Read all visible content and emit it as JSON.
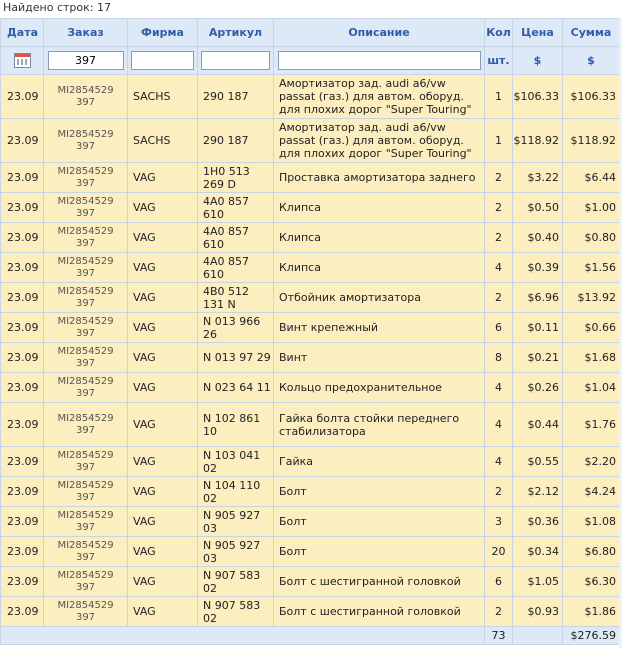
{
  "found_rows": "Найдено строк: 17",
  "columns": {
    "date": "Дата",
    "order": "Заказ",
    "firm": "Фирма",
    "article": "Артикул",
    "description": "Описание",
    "qty": "Кол",
    "price": "Цена",
    "sum": "Сумма"
  },
  "units": {
    "qty": "шт.",
    "price": "$",
    "sum": "$"
  },
  "filters": {
    "order": "397",
    "firm": "",
    "article": "",
    "description": ""
  },
  "rows": [
    {
      "date": "23.09",
      "order_line1": "MI2854529",
      "order_line2": "397",
      "firm": "SACHS",
      "article": "290 187",
      "description": "Амортизатор зад. audi a6/vw passat (газ.) для автом. оборуд. для плохих дорог \"Super Touring\"",
      "qty": "1",
      "price": "$106.33",
      "sum": "$106.33"
    },
    {
      "date": "23.09",
      "order_line1": "MI2854529",
      "order_line2": "397",
      "firm": "SACHS",
      "article": "290 187",
      "description": "Амортизатор зад. audi a6/vw passat (газ.) для автом. оборуд. для плохих дорог \"Super Touring\"",
      "qty": "1",
      "price": "$118.92",
      "sum": "$118.92"
    },
    {
      "date": "23.09",
      "order_line1": "MI2854529",
      "order_line2": "397",
      "firm": "VAG",
      "article": "1H0 513 269 D",
      "description": "Проставка амортизатора заднего",
      "qty": "2",
      "price": "$3.22",
      "sum": "$6.44"
    },
    {
      "date": "23.09",
      "order_line1": "MI2854529",
      "order_line2": "397",
      "firm": "VAG",
      "article": "4A0 857 610",
      "description": "Клипса",
      "qty": "2",
      "price": "$0.50",
      "sum": "$1.00"
    },
    {
      "date": "23.09",
      "order_line1": "MI2854529",
      "order_line2": "397",
      "firm": "VAG",
      "article": "4A0 857 610",
      "description": "Клипса",
      "qty": "2",
      "price": "$0.40",
      "sum": "$0.80"
    },
    {
      "date": "23.09",
      "order_line1": "MI2854529",
      "order_line2": "397",
      "firm": "VAG",
      "article": "4A0 857 610",
      "description": "Клипса",
      "qty": "4",
      "price": "$0.39",
      "sum": "$1.56"
    },
    {
      "date": "23.09",
      "order_line1": "MI2854529",
      "order_line2": "397",
      "firm": "VAG",
      "article": "4B0 512 131 N",
      "description": "Отбойник амортизатора",
      "qty": "2",
      "price": "$6.96",
      "sum": "$13.92"
    },
    {
      "date": "23.09",
      "order_line1": "MI2854529",
      "order_line2": "397",
      "firm": "VAG",
      "article": "N 013 966 26",
      "description": "Винт крепежный",
      "qty": "6",
      "price": "$0.11",
      "sum": "$0.66"
    },
    {
      "date": "23.09",
      "order_line1": "MI2854529",
      "order_line2": "397",
      "firm": "VAG",
      "article": "N 013 97 29",
      "description": "Винт",
      "qty": "8",
      "price": "$0.21",
      "sum": "$1.68"
    },
    {
      "date": "23.09",
      "order_line1": "MI2854529",
      "order_line2": "397",
      "firm": "VAG",
      "article": "N 023 64 11",
      "description": "Кольцо предохранительное",
      "qty": "4",
      "price": "$0.26",
      "sum": "$1.04"
    },
    {
      "date": "23.09",
      "order_line1": "MI2854529",
      "order_line2": "397",
      "firm": "VAG",
      "article": "N 102 861 10",
      "description": "Гайка болта стойки переднего стабилизатора",
      "qty": "4",
      "price": "$0.44",
      "sum": "$1.76"
    },
    {
      "date": "23.09",
      "order_line1": "MI2854529",
      "order_line2": "397",
      "firm": "VAG",
      "article": "N 103 041 02",
      "description": "Гайка",
      "qty": "4",
      "price": "$0.55",
      "sum": "$2.20"
    },
    {
      "date": "23.09",
      "order_line1": "MI2854529",
      "order_line2": "397",
      "firm": "VAG",
      "article": "N 104 110 02",
      "description": "Болт",
      "qty": "2",
      "price": "$2.12",
      "sum": "$4.24"
    },
    {
      "date": "23.09",
      "order_line1": "MI2854529",
      "order_line2": "397",
      "firm": "VAG",
      "article": "N 905 927 03",
      "description": "Болт",
      "qty": "3",
      "price": "$0.36",
      "sum": "$1.08"
    },
    {
      "date": "23.09",
      "order_line1": "MI2854529",
      "order_line2": "397",
      "firm": "VAG",
      "article": "N 905 927 03",
      "description": "Болт",
      "qty": "20",
      "price": "$0.34",
      "sum": "$6.80"
    },
    {
      "date": "23.09",
      "order_line1": "MI2854529",
      "order_line2": "397",
      "firm": "VAG",
      "article": "N 907 583 02",
      "description": "Болт с шестигранной головкой",
      "qty": "6",
      "price": "$1.05",
      "sum": "$6.30"
    },
    {
      "date": "23.09",
      "order_line1": "MI2854529",
      "order_line2": "397",
      "firm": "VAG",
      "article": "N 907 583 02",
      "description": "Болт с шестигранной головкой",
      "qty": "2",
      "price": "$0.93",
      "sum": "$1.86"
    }
  ],
  "totals": {
    "qty": "73",
    "sum": "$276.59"
  },
  "icons": {
    "date_filter": "calendar-icon"
  },
  "colors": {
    "header_bg": "#dde9f6",
    "header_text": "#2f5da8",
    "row_bg": "#fdeec0",
    "border": "#c6d4e6"
  }
}
